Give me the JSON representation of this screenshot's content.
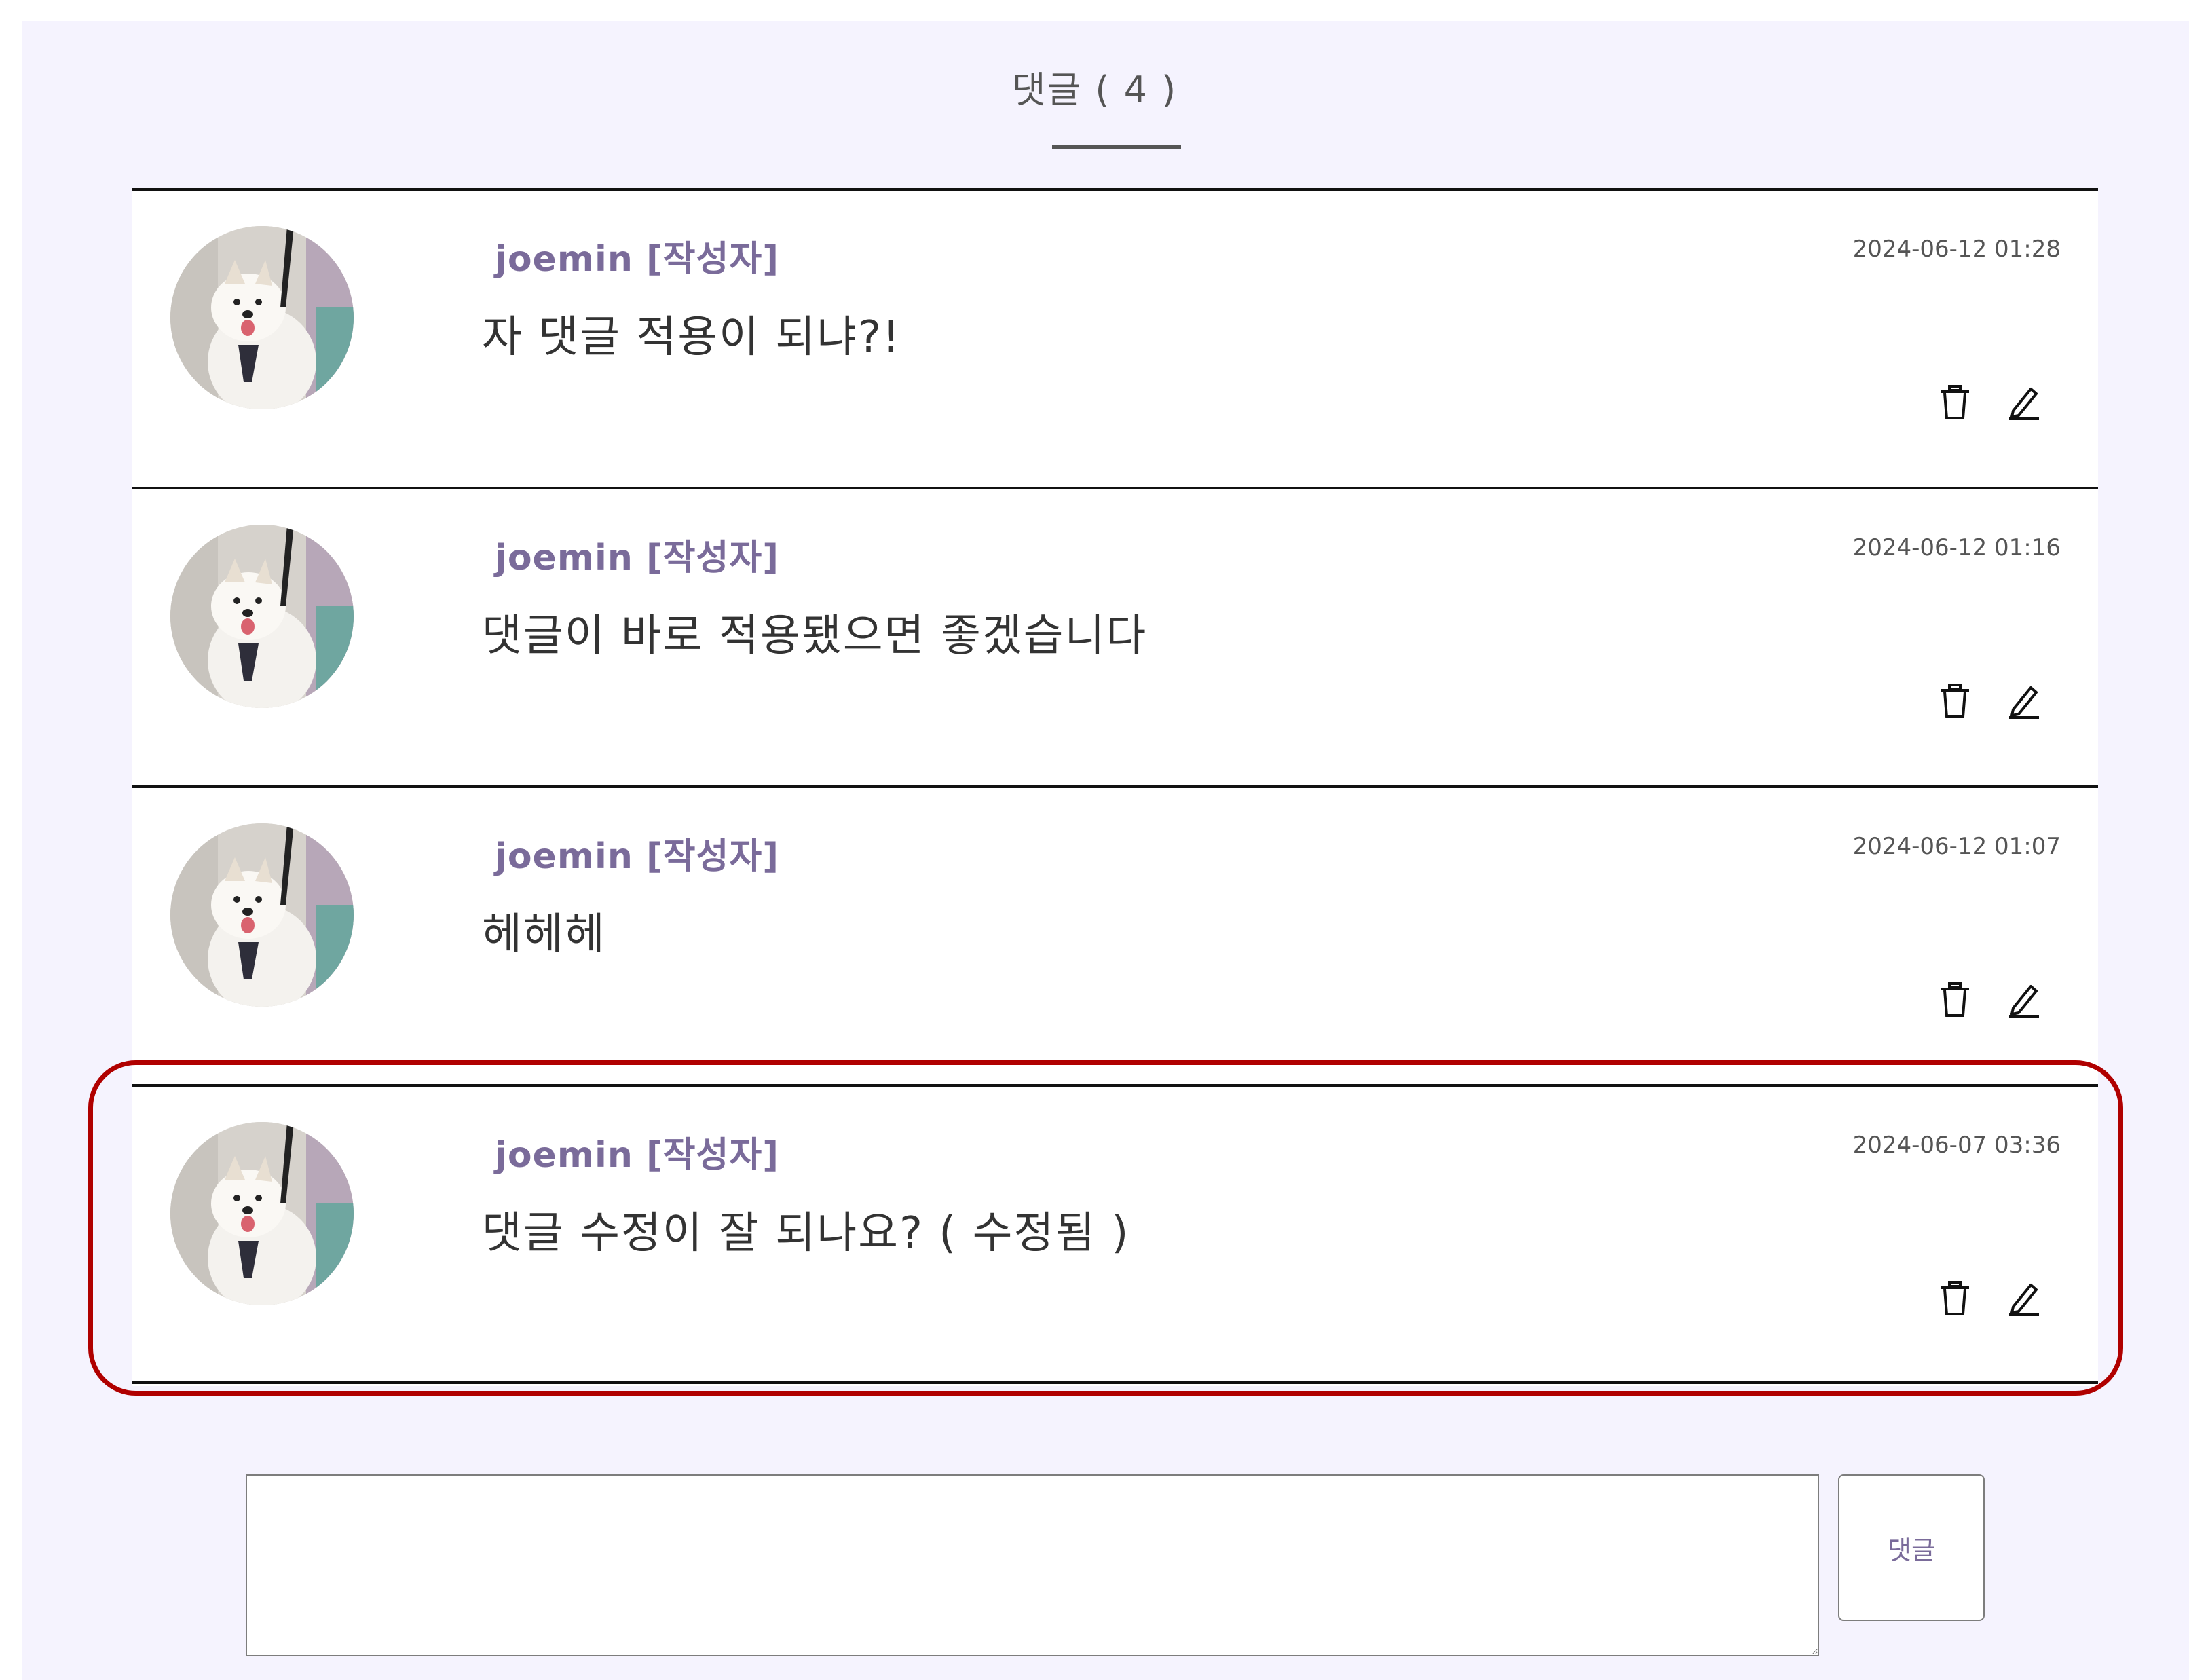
{
  "comments_section": {
    "heading": "댓글 ( 4 )",
    "comments": [
      {
        "author": "joemin [작성자]",
        "date": "2024-06-12 01:28",
        "content": "자 댓글 적용이 되냐?!"
      },
      {
        "author": "joemin [작성자]",
        "date": "2024-06-12 01:16",
        "content": "댓글이 바로 적용됐으면 좋겠습니다"
      },
      {
        "author": "joemin [작성자]",
        "date": "2024-06-12 01:07",
        "content": "헤헤헤"
      },
      {
        "author": "joemin [작성자]",
        "date": "2024-06-07 03:36",
        "content": "댓글 수정이 잘 되나요? ( 수정됨 )"
      }
    ],
    "icons": {
      "delete": "trash-icon",
      "edit": "pencil-icon"
    },
    "composer": {
      "textarea_value": "",
      "submit_label": "댓글"
    },
    "colors": {
      "background": "#f5f3fe",
      "author": "#7a6b9a",
      "highlight_border": "#b00000"
    }
  }
}
